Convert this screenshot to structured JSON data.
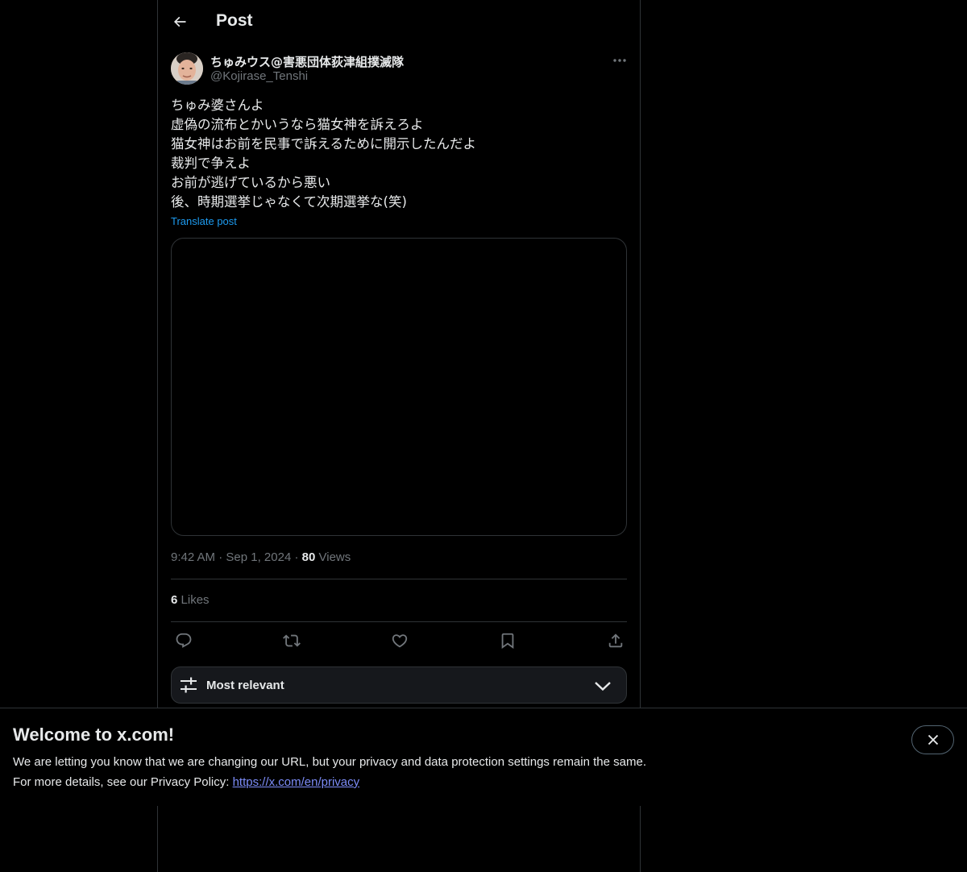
{
  "header": {
    "back_icon": "arrow-left-icon",
    "title": "Post"
  },
  "post": {
    "author": {
      "display_name": "ちゅみウス@害悪団体荻津組撲滅隊",
      "handle": "@Kojirase_Tenshi"
    },
    "text_lines": [
      "ちゅみ婆さんよ",
      "虚偽の流布とかいうなら猫女神を訴えろよ",
      "猫女神はお前を民事で訴えるために開示したんだよ",
      "裁判で争えよ",
      "お前が逃げているから悪い",
      "後、時期選挙じゃなくて次期選挙な(笑)"
    ],
    "translate_label": "Translate post",
    "time": "9:42 AM",
    "date": "Sep 1, 2024",
    "separator": "·",
    "views_count": "80",
    "views_label": "Views",
    "likes_count": "6",
    "likes_label": "Likes"
  },
  "actions": {
    "reply_icon": "reply-icon",
    "repost_icon": "repost-icon",
    "like_icon": "heart-icon",
    "bookmark_icon": "bookmark-icon",
    "share_icon": "share-icon"
  },
  "sort": {
    "label": "Most relevant",
    "icon": "sliders-icon",
    "chevron": "chevron-down-icon"
  },
  "banner": {
    "title": "Welcome to x.com!",
    "line1": "We are letting you know that we are changing our URL, but your privacy and data protection settings remain the same.",
    "line2_prefix": "For more details, see our Privacy Policy: ",
    "link": "https://x.com/en/privacy",
    "close_icon": "close-icon"
  },
  "colors": {
    "background": "#000000",
    "text": "#e7e9ea",
    "secondary_text": "#71767b",
    "accent": "#1d9bf0",
    "border": "#2f3336",
    "link": "#7c8cf8"
  }
}
